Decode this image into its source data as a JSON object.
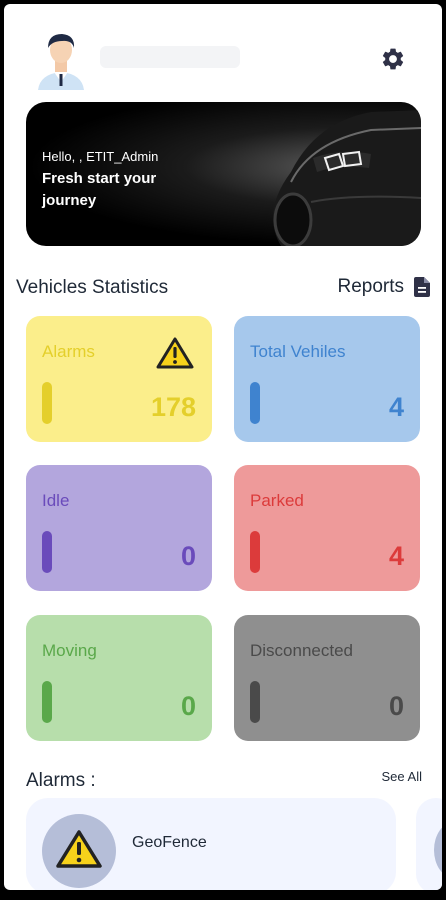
{
  "header": {
    "avatar_icon": "user-avatar-icon",
    "settings_icon": "gear-icon",
    "colors": {
      "gear": "#2f3147"
    }
  },
  "banner": {
    "greeting": "Hello, , ETIT_Admin",
    "tagline": "Fresh start your journey"
  },
  "stats": {
    "title": "Vehicles Statistics",
    "reports_label": "Reports",
    "cards": [
      {
        "label": "Alarms",
        "count": "178",
        "bg": "#fbee8b",
        "fg": "#e4cf2b",
        "bar": "#e4cf2b",
        "icon": "warning-icon"
      },
      {
        "label": "Total Vehiles",
        "count": "4",
        "bg": "#a6c8ec",
        "fg": "#3f83cf",
        "bar": "#3f83cf"
      },
      {
        "label": "Idle",
        "count": "0",
        "bg": "#b3a6dd",
        "fg": "#6a4bbb",
        "bar": "#6a4bbb"
      },
      {
        "label": "Parked",
        "count": "4",
        "bg": "#ee9a9a",
        "fg": "#dc3b3b",
        "bar": "#dc3b3b"
      },
      {
        "label": "Moving",
        "count": "0",
        "bg": "#b7deab",
        "fg": "#5aa84a",
        "bar": "#5aa84a"
      },
      {
        "label": "Disconnected",
        "count": "0",
        "bg": "#8f8f8f",
        "fg": "#4a4a4a",
        "bar": "#4a4a4a"
      }
    ]
  },
  "alarms": {
    "title": "Alarms :",
    "see_all": "See All",
    "items": [
      {
        "name": "GeoFence",
        "icon": "warning-icon"
      }
    ]
  }
}
